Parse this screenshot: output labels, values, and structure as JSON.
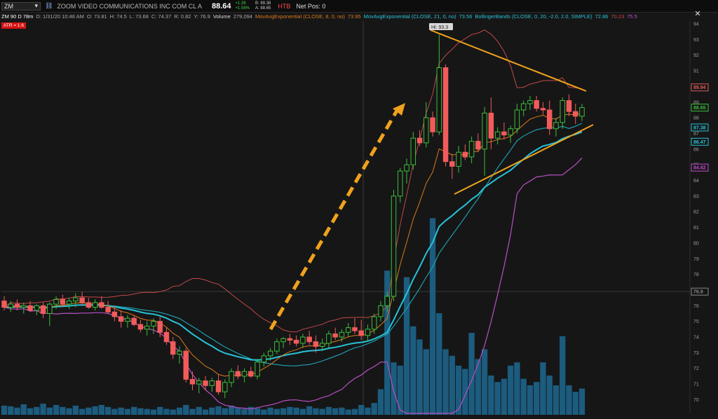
{
  "header": {
    "symbol": "ZM",
    "company": "ZOOM VIDEO COMMUNICATIONS INC COM CL A",
    "last_price": "88.64",
    "net_change": "+1.36",
    "pct_change": "+1.56%",
    "bid": "B: 88.38",
    "ask": "A: 88.65",
    "htb": "HTB",
    "net_pos": "Net Pos: 0"
  },
  "study_bar": {
    "chart_id": "ZM 90 D 78m",
    "date": "D: 1/31/20 10:48 AM",
    "open": "O: 73.81",
    "high": "H: 74.5",
    "low": "L: 73.68",
    "close": "C: 74.37",
    "range": "R: 0.82",
    "y": "Y: 76.9",
    "volume_label": "Volume",
    "volume_value": "279,094",
    "ema1_label": "MovAvgExponential (CLOSE, 8, 0, no)",
    "ema1_value": "73.95",
    "ema2_label": "MovAvgExponential (CLOSE, 21, 0, no)",
    "ema2_value": "73.56",
    "bb_label": "BollingerBands (CLOSE, 0, 20, -2.0, 2.0, SIMPLE)",
    "bb_upper": "72.86",
    "bb_mid": "70.23",
    "bb_lower": "75.5",
    "atr_tag": "ATR = 1.6"
  },
  "colors": {
    "up": "#3bbf3b",
    "down": "#f25b5b",
    "ema8": "#d97a1c",
    "ema21": "#27c3d8",
    "bb_upper": "#c0484a",
    "bb_mid": "#1fa7b8",
    "bb_lower": "#b94fc4",
    "volume": "#1c5c7f",
    "arrow": "#f0a21c",
    "trendline": "#f0a21c"
  },
  "right_axis": {
    "ticks": [
      "94",
      "93",
      "92",
      "91",
      "90",
      "89",
      "88",
      "87",
      "86",
      "85",
      "84",
      "83",
      "82",
      "81",
      "80",
      "79",
      "78",
      "77",
      "76",
      "75",
      "74",
      "73",
      "72",
      "71",
      "70"
    ],
    "price_boxes": [
      {
        "value": "89.94",
        "color": "#e05a5a",
        "price": 89.94
      },
      {
        "value": "88.65",
        "color": "#3bbf3b",
        "price": 88.65
      },
      {
        "value": "87.38",
        "color": "#27c3d8",
        "price": 87.38
      },
      {
        "value": "86.47",
        "color": "#27c3d8",
        "price": 86.47
      },
      {
        "value": "84.82",
        "color": "#c04fcf",
        "price": 84.82
      },
      {
        "value": "76.9",
        "color": "#888888",
        "price": 76.9
      }
    ]
  },
  "hi_label": "Hi: 93.3",
  "chart_data": {
    "type": "candlestick",
    "symbol": "ZM",
    "interval": "78m",
    "ylim": [
      69.5,
      94.5
    ],
    "candles": [
      {
        "o": 76.3,
        "h": 76.6,
        "l": 75.7,
        "c": 75.9
      },
      {
        "o": 75.9,
        "h": 76.3,
        "l": 75.6,
        "c": 76.1
      },
      {
        "o": 76.1,
        "h": 76.4,
        "l": 75.7,
        "c": 75.9
      },
      {
        "o": 75.9,
        "h": 76.2,
        "l": 75.5,
        "c": 76.0
      },
      {
        "o": 76.0,
        "h": 76.3,
        "l": 75.6,
        "c": 75.7
      },
      {
        "o": 75.7,
        "h": 76.1,
        "l": 75.4,
        "c": 76.0
      },
      {
        "o": 76.0,
        "h": 76.2,
        "l": 75.2,
        "c": 75.5
      },
      {
        "o": 75.5,
        "h": 76.2,
        "l": 74.7,
        "c": 76.1
      },
      {
        "o": 76.1,
        "h": 76.6,
        "l": 75.8,
        "c": 76.4
      },
      {
        "o": 76.4,
        "h": 76.7,
        "l": 75.9,
        "c": 76.1
      },
      {
        "o": 76.1,
        "h": 76.5,
        "l": 75.8,
        "c": 76.3
      },
      {
        "o": 76.3,
        "h": 76.8,
        "l": 75.9,
        "c": 76.5
      },
      {
        "o": 76.5,
        "h": 76.9,
        "l": 76.0,
        "c": 76.2
      },
      {
        "o": 76.2,
        "h": 76.5,
        "l": 75.8,
        "c": 75.9
      },
      {
        "o": 75.9,
        "h": 76.4,
        "l": 75.7,
        "c": 76.2
      },
      {
        "o": 76.2,
        "h": 76.6,
        "l": 75.8,
        "c": 75.9
      },
      {
        "o": 75.9,
        "h": 76.3,
        "l": 75.5,
        "c": 75.6
      },
      {
        "o": 75.6,
        "h": 76.0,
        "l": 75.0,
        "c": 75.3
      },
      {
        "o": 75.3,
        "h": 75.7,
        "l": 74.6,
        "c": 75.0
      },
      {
        "o": 75.0,
        "h": 75.4,
        "l": 74.6,
        "c": 75.2
      },
      {
        "o": 75.2,
        "h": 75.4,
        "l": 74.7,
        "c": 74.8
      },
      {
        "o": 74.8,
        "h": 75.1,
        "l": 74.3,
        "c": 74.5
      },
      {
        "o": 74.5,
        "h": 75.0,
        "l": 74.1,
        "c": 74.7
      },
      {
        "o": 74.7,
        "h": 75.2,
        "l": 74.2,
        "c": 75.0
      },
      {
        "o": 75.0,
        "h": 75.3,
        "l": 74.0,
        "c": 74.3
      },
      {
        "o": 74.3,
        "h": 74.6,
        "l": 73.5,
        "c": 73.7
      },
      {
        "o": 73.7,
        "h": 74.0,
        "l": 72.6,
        "c": 72.9
      },
      {
        "o": 72.9,
        "h": 73.4,
        "l": 72.3,
        "c": 73.1
      },
      {
        "o": 73.1,
        "h": 73.3,
        "l": 71.1,
        "c": 71.3
      },
      {
        "o": 71.3,
        "h": 71.8,
        "l": 70.6,
        "c": 71.0
      },
      {
        "o": 71.0,
        "h": 71.4,
        "l": 70.4,
        "c": 71.2
      },
      {
        "o": 71.2,
        "h": 71.5,
        "l": 70.6,
        "c": 70.9
      },
      {
        "o": 70.9,
        "h": 71.4,
        "l": 70.5,
        "c": 71.2
      },
      {
        "o": 71.2,
        "h": 71.6,
        "l": 70.3,
        "c": 70.5
      },
      {
        "o": 70.5,
        "h": 71.3,
        "l": 70.1,
        "c": 71.1
      },
      {
        "o": 71.1,
        "h": 72.0,
        "l": 70.8,
        "c": 71.8
      },
      {
        "o": 71.8,
        "h": 72.2,
        "l": 71.3,
        "c": 71.5
      },
      {
        "o": 71.5,
        "h": 72.0,
        "l": 71.1,
        "c": 71.8
      },
      {
        "o": 71.8,
        "h": 72.1,
        "l": 71.4,
        "c": 71.5
      },
      {
        "o": 71.5,
        "h": 72.6,
        "l": 71.3,
        "c": 72.4
      },
      {
        "o": 72.4,
        "h": 73.0,
        "l": 72.1,
        "c": 72.8
      },
      {
        "o": 72.8,
        "h": 73.3,
        "l": 72.5,
        "c": 73.1
      },
      {
        "o": 73.1,
        "h": 73.9,
        "l": 72.9,
        "c": 73.7
      },
      {
        "o": 73.7,
        "h": 74.0,
        "l": 73.3,
        "c": 73.9
      },
      {
        "o": 73.9,
        "h": 74.2,
        "l": 73.5,
        "c": 73.8
      },
      {
        "o": 73.8,
        "h": 74.1,
        "l": 73.4,
        "c": 73.6
      },
      {
        "o": 73.6,
        "h": 74.2,
        "l": 73.3,
        "c": 74.0
      },
      {
        "o": 74.0,
        "h": 74.4,
        "l": 73.5,
        "c": 73.7
      },
      {
        "o": 73.7,
        "h": 74.1,
        "l": 73.0,
        "c": 73.4
      },
      {
        "o": 73.4,
        "h": 73.9,
        "l": 73.1,
        "c": 73.6
      },
      {
        "o": 73.6,
        "h": 74.4,
        "l": 73.3,
        "c": 74.2
      },
      {
        "o": 74.2,
        "h": 74.6,
        "l": 73.8,
        "c": 74.0
      },
      {
        "o": 74.0,
        "h": 74.5,
        "l": 73.7,
        "c": 74.3
      },
      {
        "o": 74.3,
        "h": 74.9,
        "l": 74.0,
        "c": 74.6
      },
      {
        "o": 74.6,
        "h": 75.2,
        "l": 74.2,
        "c": 74.4
      },
      {
        "o": 74.4,
        "h": 75.1,
        "l": 73.8,
        "c": 74.1
      },
      {
        "o": 74.1,
        "h": 74.8,
        "l": 73.7,
        "c": 74.5
      },
      {
        "o": 74.5,
        "h": 75.5,
        "l": 74.2,
        "c": 75.3
      },
      {
        "o": 75.3,
        "h": 76.3,
        "l": 75.0,
        "c": 76.0
      },
      {
        "o": 76.0,
        "h": 76.9,
        "l": 75.6,
        "c": 76.6
      },
      {
        "o": 76.6,
        "h": 83.4,
        "l": 76.3,
        "c": 83.0
      },
      {
        "o": 83.0,
        "h": 84.8,
        "l": 82.6,
        "c": 84.6
      },
      {
        "o": 84.6,
        "h": 85.4,
        "l": 83.8,
        "c": 85.0
      },
      {
        "o": 85.0,
        "h": 87.1,
        "l": 84.7,
        "c": 86.7
      },
      {
        "o": 86.7,
        "h": 87.2,
        "l": 86.2,
        "c": 86.4
      },
      {
        "o": 86.4,
        "h": 89.0,
        "l": 86.1,
        "c": 88.0
      },
      {
        "o": 88.0,
        "h": 88.4,
        "l": 86.8,
        "c": 87.1
      },
      {
        "o": 87.1,
        "h": 93.3,
        "l": 86.9,
        "c": 91.2
      },
      {
        "o": 91.2,
        "h": 91.4,
        "l": 84.9,
        "c": 85.2
      },
      {
        "o": 85.2,
        "h": 85.7,
        "l": 84.1,
        "c": 84.9
      },
      {
        "o": 84.9,
        "h": 86.2,
        "l": 84.5,
        "c": 85.8
      },
      {
        "o": 85.8,
        "h": 86.3,
        "l": 85.3,
        "c": 85.5
      },
      {
        "o": 85.5,
        "h": 86.8,
        "l": 85.1,
        "c": 86.5
      },
      {
        "o": 86.5,
        "h": 87.0,
        "l": 85.8,
        "c": 86.0
      },
      {
        "o": 86.0,
        "h": 88.7,
        "l": 84.3,
        "c": 88.3
      },
      {
        "o": 88.3,
        "h": 89.3,
        "l": 86.0,
        "c": 86.7
      },
      {
        "o": 86.7,
        "h": 87.4,
        "l": 86.3,
        "c": 87.1
      },
      {
        "o": 87.1,
        "h": 87.7,
        "l": 86.6,
        "c": 86.9
      },
      {
        "o": 86.9,
        "h": 87.5,
        "l": 86.4,
        "c": 87.3
      },
      {
        "o": 87.3,
        "h": 88.9,
        "l": 87.0,
        "c": 88.5
      },
      {
        "o": 88.5,
        "h": 89.1,
        "l": 88.1,
        "c": 88.9
      },
      {
        "o": 88.9,
        "h": 89.4,
        "l": 88.5,
        "c": 89.1
      },
      {
        "o": 89.1,
        "h": 89.4,
        "l": 88.4,
        "c": 88.6
      },
      {
        "o": 88.6,
        "h": 89.0,
        "l": 88.2,
        "c": 88.5
      },
      {
        "o": 88.5,
        "h": 89.1,
        "l": 86.9,
        "c": 87.3
      },
      {
        "o": 87.3,
        "h": 88.0,
        "l": 86.8,
        "c": 87.7
      },
      {
        "o": 87.7,
        "h": 89.3,
        "l": 87.3,
        "c": 89.1
      },
      {
        "o": 89.1,
        "h": 89.5,
        "l": 88.1,
        "c": 88.4
      },
      {
        "o": 88.4,
        "h": 88.9,
        "l": 87.6,
        "c": 88.1
      },
      {
        "o": 88.1,
        "h": 88.9,
        "l": 87.8,
        "c": 88.65
      }
    ],
    "volume": [
      28,
      26,
      22,
      32,
      20,
      24,
      34,
      22,
      30,
      24,
      20,
      28,
      18,
      22,
      26,
      30,
      24,
      18,
      22,
      18,
      24,
      20,
      18,
      16,
      24,
      18,
      16,
      22,
      30,
      18,
      24,
      16,
      22,
      26,
      20,
      28,
      22,
      18,
      24,
      20,
      16,
      22,
      18,
      20,
      24,
      22,
      18,
      26,
      20,
      18,
      24,
      20,
      22,
      16,
      18,
      30,
      22,
      36,
      78,
      440,
      160,
      150,
      420,
      270,
      230,
      200,
      600,
      310,
      200,
      180,
      150,
      140,
      250,
      170,
      200,
      120,
      100,
      110,
      150,
      160,
      110,
      90,
      100,
      160,
      120,
      90,
      240,
      90,
      70,
      80
    ],
    "volume_max": 620
  }
}
